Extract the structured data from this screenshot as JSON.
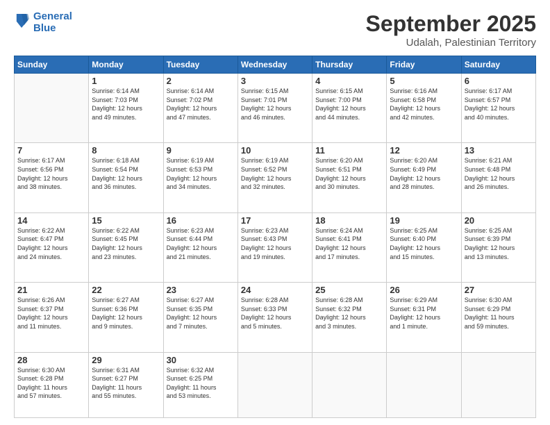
{
  "header": {
    "logo_line1": "General",
    "logo_line2": "Blue",
    "month": "September 2025",
    "location": "Udalah, Palestinian Territory"
  },
  "weekdays": [
    "Sunday",
    "Monday",
    "Tuesday",
    "Wednesday",
    "Thursday",
    "Friday",
    "Saturday"
  ],
  "weeks": [
    [
      {
        "date": "",
        "info": ""
      },
      {
        "date": "1",
        "info": "Sunrise: 6:14 AM\nSunset: 7:03 PM\nDaylight: 12 hours\nand 49 minutes."
      },
      {
        "date": "2",
        "info": "Sunrise: 6:14 AM\nSunset: 7:02 PM\nDaylight: 12 hours\nand 47 minutes."
      },
      {
        "date": "3",
        "info": "Sunrise: 6:15 AM\nSunset: 7:01 PM\nDaylight: 12 hours\nand 46 minutes."
      },
      {
        "date": "4",
        "info": "Sunrise: 6:15 AM\nSunset: 7:00 PM\nDaylight: 12 hours\nand 44 minutes."
      },
      {
        "date": "5",
        "info": "Sunrise: 6:16 AM\nSunset: 6:58 PM\nDaylight: 12 hours\nand 42 minutes."
      },
      {
        "date": "6",
        "info": "Sunrise: 6:17 AM\nSunset: 6:57 PM\nDaylight: 12 hours\nand 40 minutes."
      }
    ],
    [
      {
        "date": "7",
        "info": "Sunrise: 6:17 AM\nSunset: 6:56 PM\nDaylight: 12 hours\nand 38 minutes."
      },
      {
        "date": "8",
        "info": "Sunrise: 6:18 AM\nSunset: 6:54 PM\nDaylight: 12 hours\nand 36 minutes."
      },
      {
        "date": "9",
        "info": "Sunrise: 6:19 AM\nSunset: 6:53 PM\nDaylight: 12 hours\nand 34 minutes."
      },
      {
        "date": "10",
        "info": "Sunrise: 6:19 AM\nSunset: 6:52 PM\nDaylight: 12 hours\nand 32 minutes."
      },
      {
        "date": "11",
        "info": "Sunrise: 6:20 AM\nSunset: 6:51 PM\nDaylight: 12 hours\nand 30 minutes."
      },
      {
        "date": "12",
        "info": "Sunrise: 6:20 AM\nSunset: 6:49 PM\nDaylight: 12 hours\nand 28 minutes."
      },
      {
        "date": "13",
        "info": "Sunrise: 6:21 AM\nSunset: 6:48 PM\nDaylight: 12 hours\nand 26 minutes."
      }
    ],
    [
      {
        "date": "14",
        "info": "Sunrise: 6:22 AM\nSunset: 6:47 PM\nDaylight: 12 hours\nand 24 minutes."
      },
      {
        "date": "15",
        "info": "Sunrise: 6:22 AM\nSunset: 6:45 PM\nDaylight: 12 hours\nand 23 minutes."
      },
      {
        "date": "16",
        "info": "Sunrise: 6:23 AM\nSunset: 6:44 PM\nDaylight: 12 hours\nand 21 minutes."
      },
      {
        "date": "17",
        "info": "Sunrise: 6:23 AM\nSunset: 6:43 PM\nDaylight: 12 hours\nand 19 minutes."
      },
      {
        "date": "18",
        "info": "Sunrise: 6:24 AM\nSunset: 6:41 PM\nDaylight: 12 hours\nand 17 minutes."
      },
      {
        "date": "19",
        "info": "Sunrise: 6:25 AM\nSunset: 6:40 PM\nDaylight: 12 hours\nand 15 minutes."
      },
      {
        "date": "20",
        "info": "Sunrise: 6:25 AM\nSunset: 6:39 PM\nDaylight: 12 hours\nand 13 minutes."
      }
    ],
    [
      {
        "date": "21",
        "info": "Sunrise: 6:26 AM\nSunset: 6:37 PM\nDaylight: 12 hours\nand 11 minutes."
      },
      {
        "date": "22",
        "info": "Sunrise: 6:27 AM\nSunset: 6:36 PM\nDaylight: 12 hours\nand 9 minutes."
      },
      {
        "date": "23",
        "info": "Sunrise: 6:27 AM\nSunset: 6:35 PM\nDaylight: 12 hours\nand 7 minutes."
      },
      {
        "date": "24",
        "info": "Sunrise: 6:28 AM\nSunset: 6:33 PM\nDaylight: 12 hours\nand 5 minutes."
      },
      {
        "date": "25",
        "info": "Sunrise: 6:28 AM\nSunset: 6:32 PM\nDaylight: 12 hours\nand 3 minutes."
      },
      {
        "date": "26",
        "info": "Sunrise: 6:29 AM\nSunset: 6:31 PM\nDaylight: 12 hours\nand 1 minute."
      },
      {
        "date": "27",
        "info": "Sunrise: 6:30 AM\nSunset: 6:29 PM\nDaylight: 11 hours\nand 59 minutes."
      }
    ],
    [
      {
        "date": "28",
        "info": "Sunrise: 6:30 AM\nSunset: 6:28 PM\nDaylight: 11 hours\nand 57 minutes."
      },
      {
        "date": "29",
        "info": "Sunrise: 6:31 AM\nSunset: 6:27 PM\nDaylight: 11 hours\nand 55 minutes."
      },
      {
        "date": "30",
        "info": "Sunrise: 6:32 AM\nSunset: 6:25 PM\nDaylight: 11 hours\nand 53 minutes."
      },
      {
        "date": "",
        "info": ""
      },
      {
        "date": "",
        "info": ""
      },
      {
        "date": "",
        "info": ""
      },
      {
        "date": "",
        "info": ""
      }
    ]
  ]
}
